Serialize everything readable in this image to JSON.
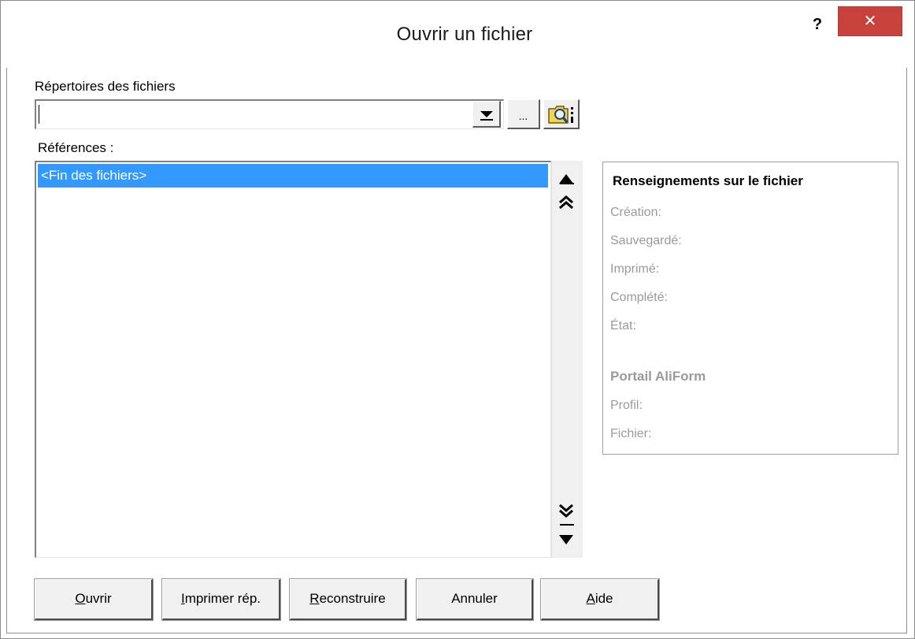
{
  "window": {
    "title": "Ouvrir un fichier",
    "help_label": "?",
    "close_label": "✕"
  },
  "directory": {
    "label": "Répertoires des fichiers",
    "value": "",
    "browse_label": "..."
  },
  "references": {
    "label": "Références :",
    "items": [
      "<Fin des fichiers>"
    ]
  },
  "file_info": {
    "title": "Renseignements sur le fichier",
    "fields": [
      "Création:",
      "Sauvegardé:",
      "Imprimé:",
      "Complété:",
      "État:"
    ],
    "portal_title": "Portail AliForm",
    "portal_fields": [
      "Profil:",
      "Fichier:"
    ]
  },
  "buttons": {
    "open": {
      "accel": "O",
      "rest": "uvrir"
    },
    "print": {
      "accel": "I",
      "rest": "mprimer rép."
    },
    "rebuild": {
      "accel": "R",
      "rest": "econstruire"
    },
    "cancel": {
      "accel": "",
      "rest": "Annuler"
    },
    "help": {
      "accel": "A",
      "rest": "ide"
    }
  },
  "colors": {
    "selection": "#3399ff",
    "close_button": "#c7423b",
    "disabled_text": "#9a9a9a"
  },
  "icons": {
    "dropdown": "chevron-down-icon",
    "folder_search": "folder-search-icon",
    "scroll_up": "arrow-up-icon",
    "page_up": "double-chevron-up-icon",
    "page_down": "double-chevron-down-icon",
    "scroll_down": "arrow-down-icon"
  }
}
